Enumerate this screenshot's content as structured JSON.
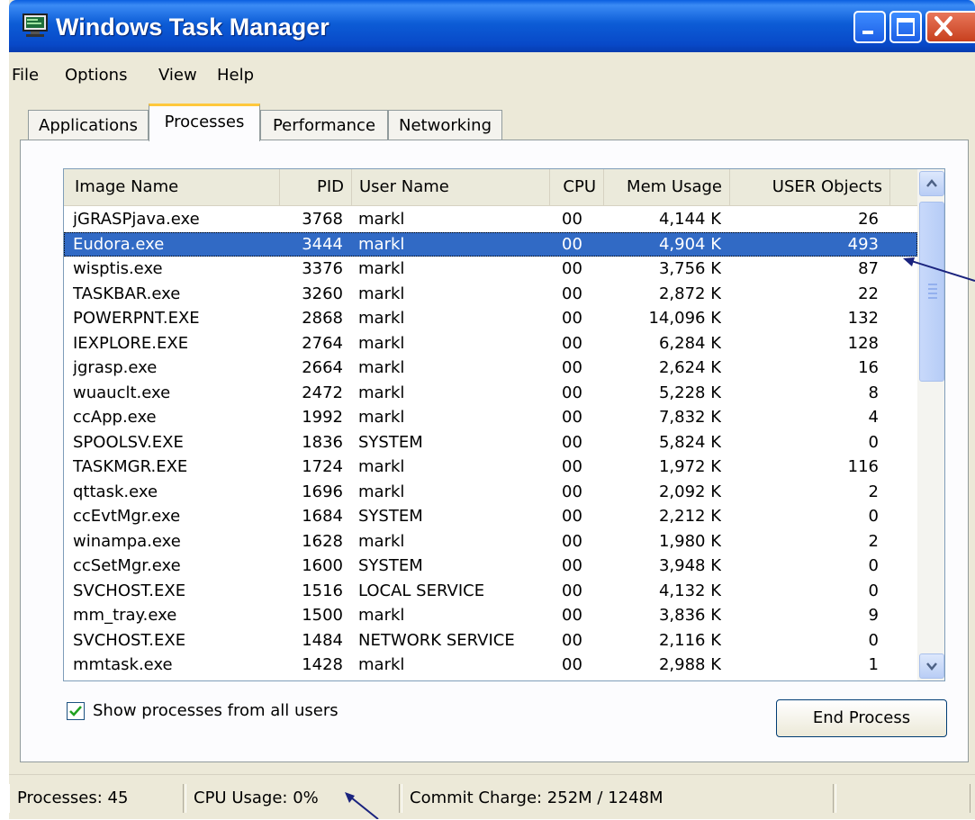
{
  "window": {
    "title": "Windows Task Manager",
    "icon": "monitor-icon"
  },
  "titlebar_buttons": [
    "minimize-icon",
    "maximize-icon",
    "close-icon"
  ],
  "menu": [
    {
      "label": "File"
    },
    {
      "label": "Options"
    },
    {
      "label": "View"
    },
    {
      "label": "Help"
    }
  ],
  "tabs": [
    {
      "label": "Applications",
      "active": false
    },
    {
      "label": "Processes",
      "active": true
    },
    {
      "label": "Performance",
      "active": false
    },
    {
      "label": "Networking",
      "active": false
    }
  ],
  "table": {
    "columns": [
      "Image Name",
      "PID",
      "User Name",
      "CPU",
      "Mem Usage",
      "USER Objects"
    ],
    "selected_index": 1,
    "rows": [
      {
        "name": "jGRASPjava.exe",
        "pid": "3768",
        "user": "markl",
        "cpu": "00",
        "mem": "4,144 K",
        "objects": "26"
      },
      {
        "name": "Eudora.exe",
        "pid": "3444",
        "user": "markl",
        "cpu": "00",
        "mem": "4,904 K",
        "objects": "493"
      },
      {
        "name": "wisptis.exe",
        "pid": "3376",
        "user": "markl",
        "cpu": "00",
        "mem": "3,756 K",
        "objects": "87"
      },
      {
        "name": "TASKBAR.exe",
        "pid": "3260",
        "user": "markl",
        "cpu": "00",
        "mem": "2,872 K",
        "objects": "22"
      },
      {
        "name": "POWERPNT.EXE",
        "pid": "2868",
        "user": "markl",
        "cpu": "00",
        "mem": "14,096 K",
        "objects": "132"
      },
      {
        "name": "IEXPLORE.EXE",
        "pid": "2764",
        "user": "markl",
        "cpu": "00",
        "mem": "6,284 K",
        "objects": "128"
      },
      {
        "name": "jgrasp.exe",
        "pid": "2664",
        "user": "markl",
        "cpu": "00",
        "mem": "2,624 K",
        "objects": "16"
      },
      {
        "name": "wuauclt.exe",
        "pid": "2472",
        "user": "markl",
        "cpu": "00",
        "mem": "5,228 K",
        "objects": "8"
      },
      {
        "name": "ccApp.exe",
        "pid": "1992",
        "user": "markl",
        "cpu": "00",
        "mem": "7,832 K",
        "objects": "4"
      },
      {
        "name": "SPOOLSV.EXE",
        "pid": "1836",
        "user": "SYSTEM",
        "cpu": "00",
        "mem": "5,824 K",
        "objects": "0"
      },
      {
        "name": "TASKMGR.EXE",
        "pid": "1724",
        "user": "markl",
        "cpu": "00",
        "mem": "1,972 K",
        "objects": "116"
      },
      {
        "name": "qttask.exe",
        "pid": "1696",
        "user": "markl",
        "cpu": "00",
        "mem": "2,092 K",
        "objects": "2"
      },
      {
        "name": "ccEvtMgr.exe",
        "pid": "1684",
        "user": "SYSTEM",
        "cpu": "00",
        "mem": "2,212 K",
        "objects": "0"
      },
      {
        "name": "winampa.exe",
        "pid": "1628",
        "user": "markl",
        "cpu": "00",
        "mem": "1,980 K",
        "objects": "2"
      },
      {
        "name": "ccSetMgr.exe",
        "pid": "1600",
        "user": "SYSTEM",
        "cpu": "00",
        "mem": "3,948 K",
        "objects": "0"
      },
      {
        "name": "SVCHOST.EXE",
        "pid": "1516",
        "user": "LOCAL SERVICE",
        "cpu": "00",
        "mem": "4,132 K",
        "objects": "0"
      },
      {
        "name": "mm_tray.exe",
        "pid": "1500",
        "user": "markl",
        "cpu": "00",
        "mem": "3,836 K",
        "objects": "9"
      },
      {
        "name": "SVCHOST.EXE",
        "pid": "1484",
        "user": "NETWORK SERVICE",
        "cpu": "00",
        "mem": "2,116 K",
        "objects": "0"
      },
      {
        "name": "mmtask.exe",
        "pid": "1428",
        "user": "markl",
        "cpu": "00",
        "mem": "2,988 K",
        "objects": "1"
      }
    ]
  },
  "show_all_users": {
    "label": "Show processes from all users",
    "checked": true
  },
  "end_process": {
    "label": "End Process"
  },
  "status": {
    "processes": "Processes: 45",
    "cpu_usage": "CPU Usage: 0%",
    "commit_charge": "Commit Charge: 252M / 1248M"
  },
  "colors": {
    "titlebar": "#0a5ee0",
    "selection": "#316ac5",
    "window_bg": "#ece9d8",
    "annotation_arrow": "#1a237e",
    "tab_highlight": "#ffc83c"
  }
}
